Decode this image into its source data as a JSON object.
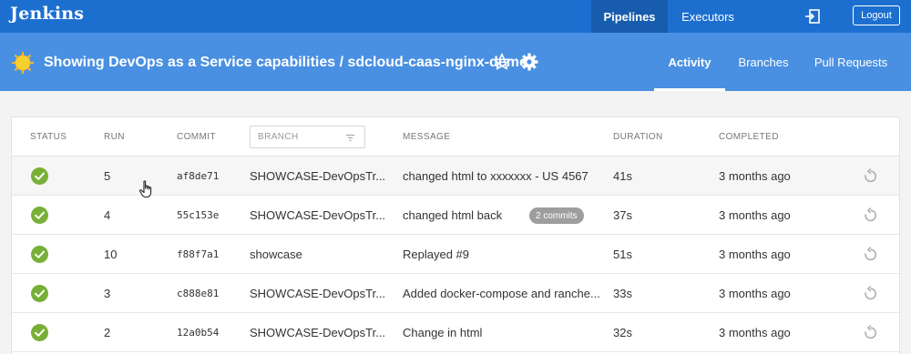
{
  "app": {
    "logo": "Jenkins"
  },
  "topnav": {
    "pipelines": "Pipelines",
    "executors": "Executors",
    "logout": "Logout",
    "exit_icon": "exit-icon"
  },
  "pipeline": {
    "title": "Showing DevOps as a Service capabilities / sdcloud-caas-nginx-demo",
    "status_icon": "sun-icon",
    "tabs": [
      "Activity",
      "Branches",
      "Pull Requests"
    ],
    "active_tab": "Activity"
  },
  "table": {
    "headers": {
      "status": "STATUS",
      "run": "RUN",
      "commit": "COMMIT",
      "branch": "BRANCH",
      "message": "MESSAGE",
      "duration": "DURATION",
      "completed": "COMPLETED"
    },
    "rows": [
      {
        "run": "5",
        "commit": "af8de71",
        "branch": "SHOWCASE-DevOpsTr...",
        "message": "changed html to xxxxxxx - US 4567",
        "badge": "",
        "duration": "41s",
        "completed": "3 months ago"
      },
      {
        "run": "4",
        "commit": "55c153e",
        "branch": "SHOWCASE-DevOpsTr...",
        "message": "changed html back",
        "badge": "2 commits",
        "duration": "37s",
        "completed": "3 months ago"
      },
      {
        "run": "10",
        "commit": "f88f7a1",
        "branch": "showcase",
        "message": "Replayed #9",
        "badge": "",
        "duration": "51s",
        "completed": "3 months ago"
      },
      {
        "run": "3",
        "commit": "c888e81",
        "branch": "SHOWCASE-DevOpsTr...",
        "message": "Added docker-compose and ranche...",
        "badge": "",
        "duration": "33s",
        "completed": "3 months ago"
      },
      {
        "run": "2",
        "commit": "12a0b54",
        "branch": "SHOWCASE-DevOpsTr...",
        "message": "Change in html",
        "badge": "",
        "duration": "32s",
        "completed": "3 months ago"
      }
    ]
  },
  "colors": {
    "topbar": "#1d6fcf",
    "header": "#4a90e2",
    "success": "#78b037",
    "sun": "#f5d130"
  }
}
